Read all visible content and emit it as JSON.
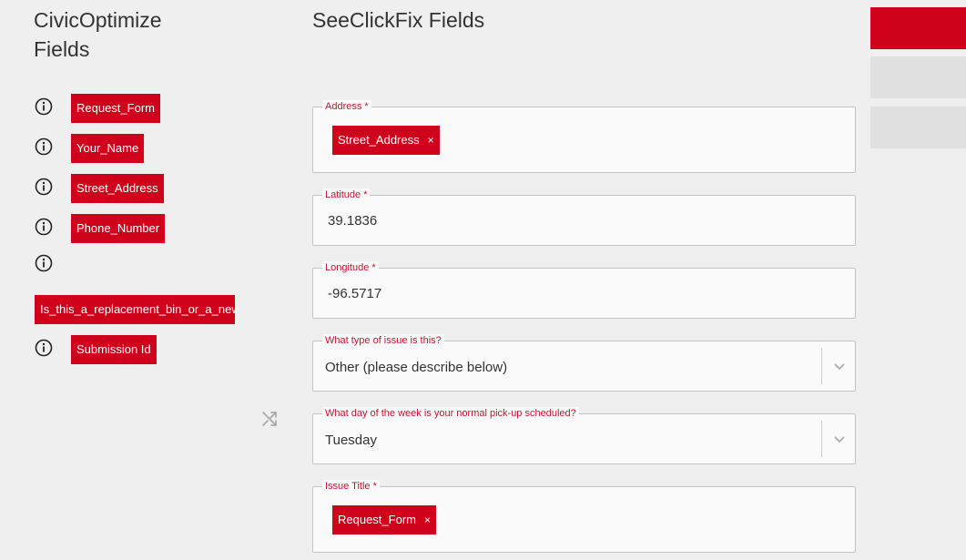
{
  "left": {
    "title_line1": "CivicOptimize",
    "title_line2": "Fields",
    "fields": [
      {
        "label": "Request_Form"
      },
      {
        "label": "Your_Name"
      },
      {
        "label": "Street_Address"
      },
      {
        "label": "Phone_Number"
      },
      {
        "label": "Is_this_a_replacement_bin_or_a_new_"
      },
      {
        "label": "Submission Id"
      }
    ]
  },
  "right": {
    "title": "SeeClickFix Fields",
    "address": {
      "label": "Address *",
      "tag": "Street_Address",
      "remove": "×"
    },
    "latitude": {
      "label": "Latitude *",
      "value": "39.1836"
    },
    "longitude": {
      "label": "Longitude *",
      "value": "-96.5717"
    },
    "issue_type": {
      "label": "What type of issue is this?",
      "value": "Other (please describe below)"
    },
    "pickup_day": {
      "label": "What day of the week is your normal pick-up scheduled?",
      "value": "Tuesday"
    },
    "issue_title": {
      "label": "Issue Title *",
      "tag": "Request_Form",
      "remove": "×"
    }
  },
  "colors": {
    "accent": "#d0021b",
    "label": "#c8102e",
    "panel_button": "#e0e0e0"
  },
  "icons": [
    "info-icon",
    "shuffle-icon",
    "chevron-down-icon",
    "close-icon"
  ]
}
